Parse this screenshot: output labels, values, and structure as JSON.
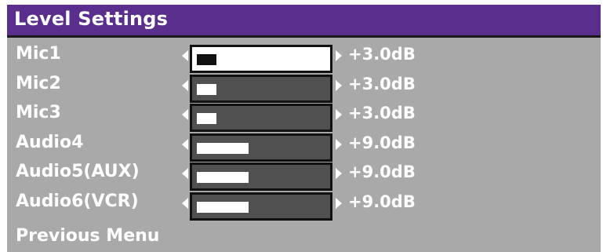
{
  "title": "Level Settings",
  "channels": [
    {
      "label": "Mic1",
      "value": "+3.0dB",
      "level": 0.15,
      "selected": true
    },
    {
      "label": "Mic2",
      "value": "+3.0dB",
      "level": 0.15,
      "selected": false
    },
    {
      "label": "Mic3",
      "value": "+3.0dB",
      "level": 0.15,
      "selected": false
    },
    {
      "label": "Audio4",
      "value": "+9.0dB",
      "level": 0.4,
      "selected": false
    },
    {
      "label": "Audio5(AUX)",
      "value": "+9.0dB",
      "level": 0.4,
      "selected": false
    },
    {
      "label": "Audio6(VCR)",
      "value": "+9.0dB",
      "level": 0.4,
      "selected": false
    }
  ],
  "previous_menu": "Previous Menu",
  "colors": {
    "title_bar": "#5a2e8c",
    "panel": "#a9a9a9",
    "slider_track": "#505050",
    "slider_selected": "#ffffff"
  }
}
